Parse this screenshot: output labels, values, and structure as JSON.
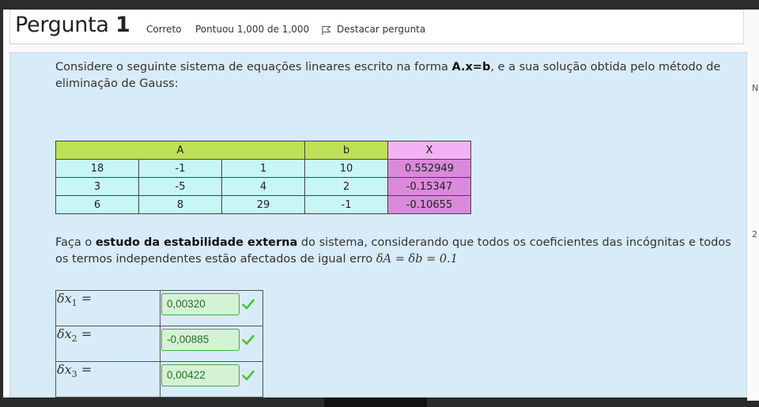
{
  "header": {
    "question_label": "Pergunta",
    "question_number": "1",
    "status": "Correto",
    "score": "Pontuou 1,000 de 1,000",
    "flag_label": "Destacar pergunta"
  },
  "intro": {
    "text_1": "Considere o seguinte sistema de equações lineares escrito na forma ",
    "bold": "A.x=b",
    "text_2": ", e a sua solução obtida pelo método de eliminação de Gauss:"
  },
  "matrix": {
    "headers": {
      "A": "A",
      "b": "b",
      "X": "X"
    },
    "rows": [
      {
        "a": [
          "18",
          "-1",
          "1"
        ],
        "b": "10",
        "x": "0.552949"
      },
      {
        "a": [
          "3",
          "-5",
          "4"
        ],
        "b": "2",
        "x": "-0.15347"
      },
      {
        "a": [
          "6",
          "8",
          "29"
        ],
        "b": "-1",
        "x": "-0.10655"
      }
    ]
  },
  "instruction": {
    "text_1": "Faça o ",
    "bold": "estudo da estabilidade externa",
    "text_2": " do sistema, considerando que todos os coeficientes das incógnitas e todos os termos independentes estão afectados de igual erro ",
    "formula": "δA = δb = 0.1"
  },
  "answers": [
    {
      "label": "δx",
      "sub": "1",
      "eq": " =",
      "value": "0,00320"
    },
    {
      "label": "δx",
      "sub": "2",
      "eq": " =",
      "value": "-0,00885"
    },
    {
      "label": "δx",
      "sub": "3",
      "eq": " =",
      "value": "0,00422"
    }
  ],
  "background_fragments": [
    "N",
    "2"
  ],
  "colors": {
    "content_bg": "#d8ebf8",
    "header_green": "#bde155",
    "cell_cyan": "#c8f6f6",
    "x_header_pink": "#f4b2f4",
    "x_value_purple": "#d98ad9",
    "correct_green": "#4ba94b"
  }
}
